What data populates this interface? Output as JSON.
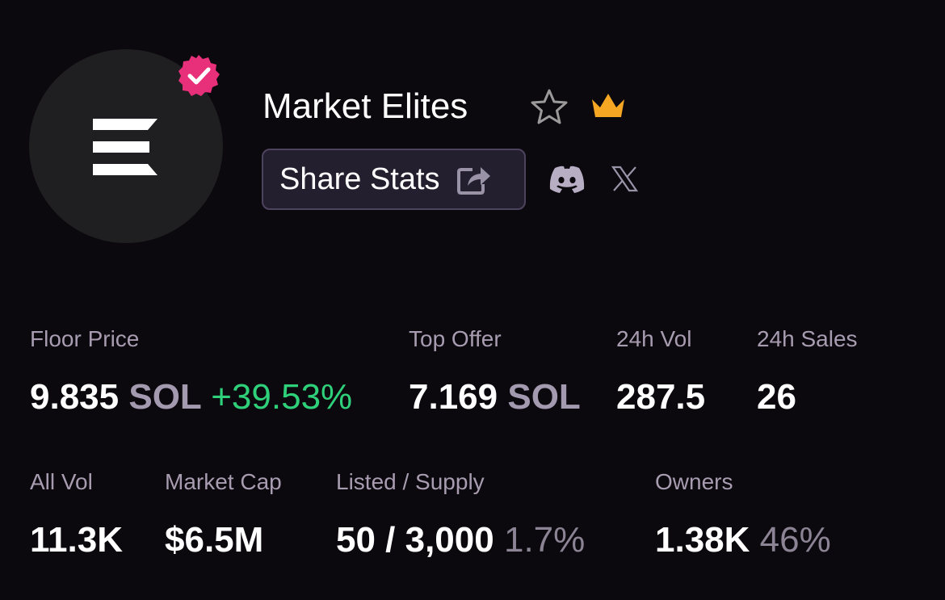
{
  "collection": {
    "name": "Market Elites",
    "share_label": "Share Stats"
  },
  "icons": {
    "verified": "verified-badge-icon",
    "favorite": "star-icon",
    "premium": "crown-icon",
    "share": "share-icon",
    "discord": "discord-icon",
    "x": "x-icon"
  },
  "colors": {
    "background": "#0b080e",
    "verified": "#e8307a",
    "crown": "#f5a623",
    "positive": "#2fd07a",
    "label": "#a89cb0"
  },
  "stats": {
    "floor_price": {
      "label": "Floor Price",
      "value": "9.835",
      "unit": "SOL",
      "change": "+39.53%"
    },
    "top_offer": {
      "label": "Top Offer",
      "value": "7.169",
      "unit": "SOL"
    },
    "vol_24h": {
      "label": "24h Vol",
      "value": "287.5"
    },
    "sales_24h": {
      "label": "24h Sales",
      "value": "26"
    },
    "all_vol": {
      "label": "All Vol",
      "value": "11.3K"
    },
    "market_cap": {
      "label": "Market Cap",
      "value": "$6.5M"
    },
    "listed_supply": {
      "label": "Listed / Supply",
      "value": "50 / 3,000",
      "pct": "1.7%"
    },
    "owners": {
      "label": "Owners",
      "value": "1.38K",
      "pct": "46%"
    }
  }
}
